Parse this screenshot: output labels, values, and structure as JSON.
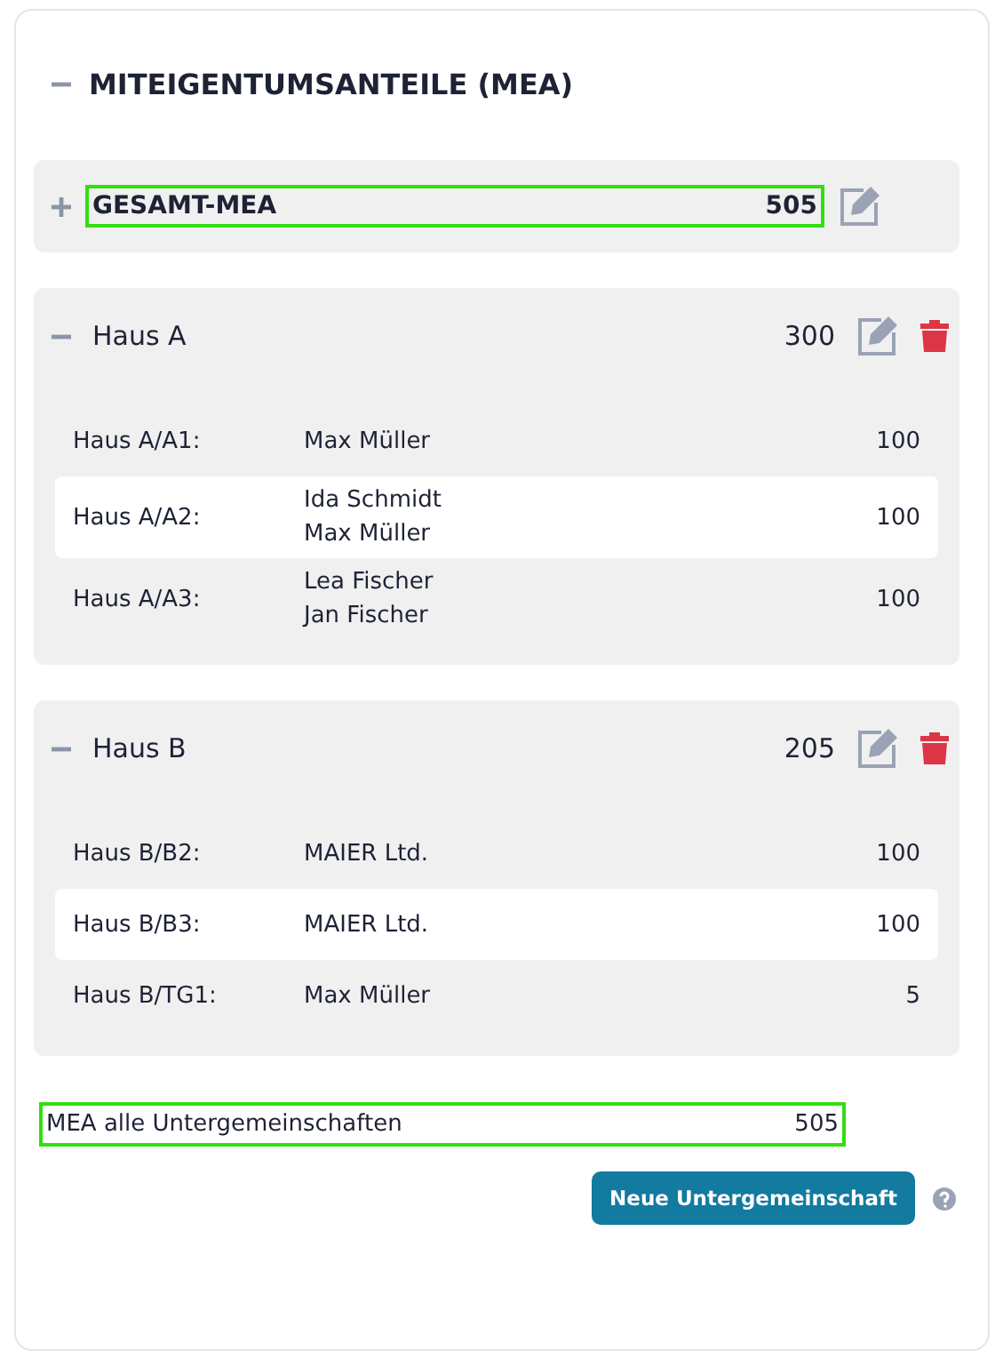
{
  "section": {
    "title": "MITEIGENTUMSANTEILE (MEA)",
    "expanded": true
  },
  "total": {
    "label": "GESAMT-MEA",
    "value": "505",
    "expanded": false,
    "highlighted": true
  },
  "groups": [
    {
      "name": "Haus A",
      "value": "300",
      "expanded": true,
      "rows": [
        {
          "unit": "Haus A/A1:",
          "owners": [
            "Max Müller"
          ],
          "value": "100"
        },
        {
          "unit": "Haus A/A2:",
          "owners": [
            "Ida Schmidt",
            "Max Müller"
          ],
          "value": "100"
        },
        {
          "unit": "Haus A/A3:",
          "owners": [
            "Lea Fischer",
            "Jan Fischer"
          ],
          "value": "100"
        }
      ]
    },
    {
      "name": "Haus B",
      "value": "205",
      "expanded": true,
      "rows": [
        {
          "unit": "Haus B/B2:",
          "owners": [
            "MAIER Ltd."
          ],
          "value": "100"
        },
        {
          "unit": "Haus B/B3:",
          "owners": [
            "MAIER Ltd."
          ],
          "value": "100"
        },
        {
          "unit": "Haus B/TG1:",
          "owners": [
            "Max Müller"
          ],
          "value": "5"
        }
      ]
    }
  ],
  "summary": {
    "label": "MEA alle Untergemeinschaften",
    "value": "505",
    "highlighted": true
  },
  "button": "Neue Untergemeinschaft"
}
